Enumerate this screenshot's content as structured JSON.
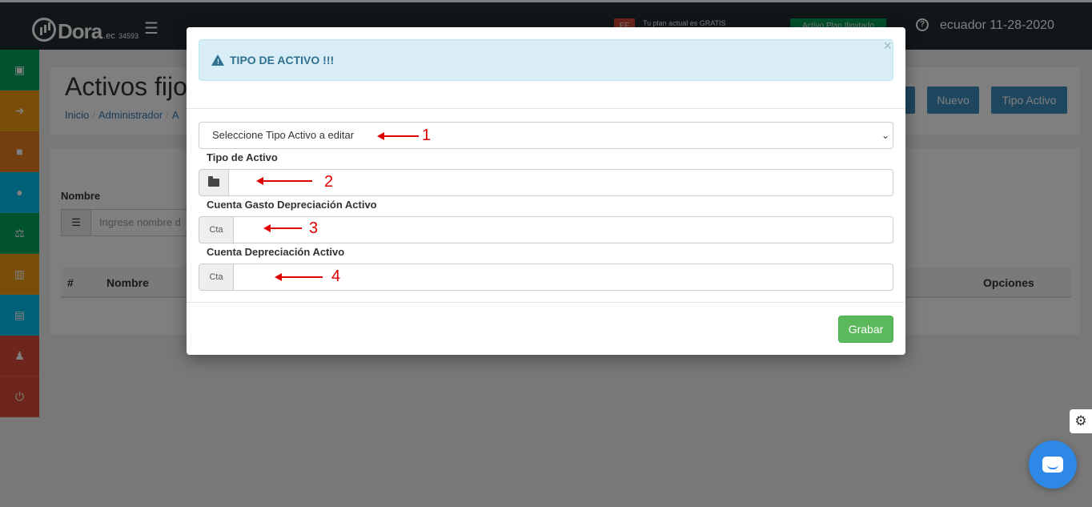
{
  "navbar": {
    "brand": "Dora",
    "brand_suffix": ".ec",
    "brand_number": "34593",
    "ff_badge": "FF",
    "plan_text": "Tu plan actual es GRATIS",
    "plan_badge": "Activo Plan Ilimitado",
    "user_label": "ecuador 11-28-2020"
  },
  "sidebar": {
    "items": [
      {
        "icon": "money-icon",
        "glyph": "▣",
        "color": "#00a65a"
      },
      {
        "icon": "sign-in-icon",
        "glyph": "➜",
        "color": "#f39c12"
      },
      {
        "icon": "briefcase-icon",
        "glyph": "■",
        "color": "#e67e22"
      },
      {
        "icon": "users-icon",
        "glyph": "●",
        "color": "#00c0ef"
      },
      {
        "icon": "balance-scale-icon",
        "glyph": "⚖",
        "color": "#00a65a"
      },
      {
        "icon": "bar-chart-icon",
        "glyph": "▥",
        "color": "#f39c12"
      },
      {
        "icon": "archive-icon",
        "glyph": "▤",
        "color": "#00c0ef"
      },
      {
        "icon": "user-icon",
        "glyph": "♟",
        "color": "#dd4b39"
      },
      {
        "icon": "power-icon",
        "glyph": "⏻",
        "color": "#dd4b39"
      }
    ]
  },
  "page": {
    "title": "Activos fijo",
    "breadcrumb": [
      "Inicio",
      "Administrador",
      "A"
    ],
    "buttons": {
      "hidden_blue": "",
      "nuevo": "Nuevo",
      "tipo_activo": "Tipo Activo"
    },
    "search_label": "Nombre",
    "search_placeholder": "Ingrese nombre d",
    "table_headers": {
      "num": "#",
      "nombre": "Nombre",
      "opciones": "Opciones"
    }
  },
  "modal": {
    "alert_title": "TIPO DE ACTIVO !!!",
    "close_symbol": "×",
    "select_placeholder": "Seleccione Tipo Activo a editar",
    "fields": {
      "tipo_activo": {
        "label": "Tipo de Activo",
        "value": ""
      },
      "cuenta_gasto": {
        "label": "Cuenta Gasto Depreciación Activo",
        "addon": "Cta",
        "value": ""
      },
      "cuenta_depreciacion": {
        "label": "Cuenta Depreciación Activo",
        "addon": "Cta",
        "value": ""
      }
    },
    "save_label": "Grabar",
    "annotations": [
      "1",
      "2",
      "3",
      "4"
    ]
  }
}
